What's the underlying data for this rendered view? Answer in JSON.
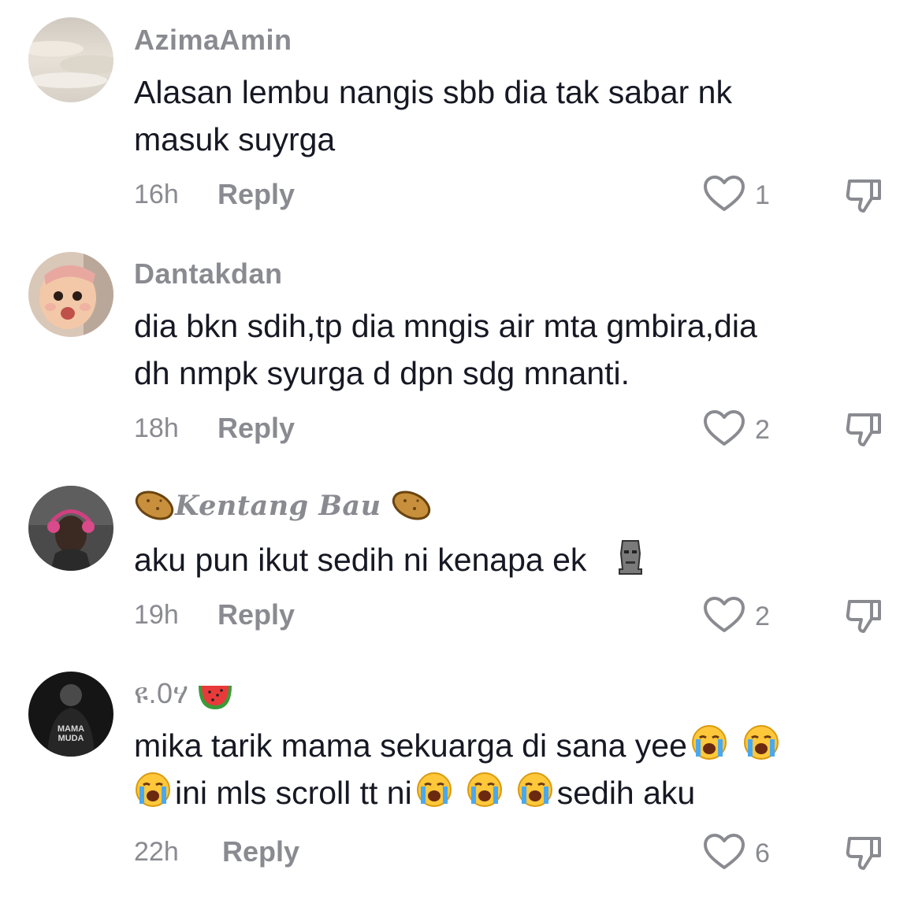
{
  "comments": [
    {
      "username": "AzimaAmin",
      "text": [
        "Alasan lembu nangis sbb dia tak sabar nk",
        "masuk suyrga"
      ],
      "time": "16h",
      "reply": "Reply",
      "likes": "1"
    },
    {
      "username": "Dantakdan",
      "text": [
        "dia bkn sdih,tp dia mngis air mta gmbira,dia",
        "dh nmpk syurga d dpn sdg mnanti."
      ],
      "time": "18h",
      "reply": "Reply",
      "likes": "2"
    },
    {
      "username": "Kentang Bau",
      "text": [
        "aku pun ikut sedih ni kenapa ek"
      ],
      "time": "19h",
      "reply": "Reply",
      "likes": "2"
    },
    {
      "username": "ዩ.0ሃ",
      "text_line1": "mika tarik mama sekuarga di sana yee",
      "text_line2a": "ini mls scroll tt ni",
      "text_line2b": "sedih aku",
      "time": "22h",
      "reply": "Reply",
      "likes": "6"
    }
  ],
  "avatar_badge": {
    "line1": "MAMA",
    "line2": "MUDA"
  },
  "icons": {
    "like": "heart-outline-icon",
    "dislike": "thumbs-down-icon",
    "potato": "potato-emoji",
    "moai": "moai-emoji",
    "watermelon": "watermelon-emoji",
    "crying": "loudly-crying-face-emoji"
  },
  "colors": {
    "text": "#161823",
    "muted": "#8a8b91",
    "icon": "#8a8b91"
  }
}
